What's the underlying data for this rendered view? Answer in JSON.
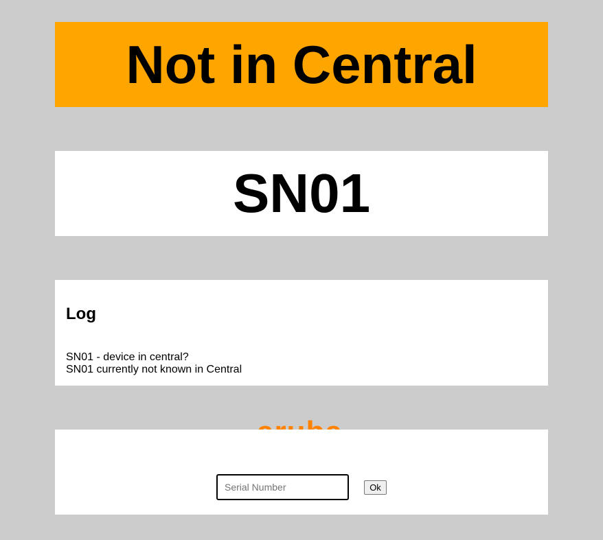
{
  "status": {
    "text": "Not in Central",
    "background": "#ffa500"
  },
  "serial": {
    "value": "SN01"
  },
  "log": {
    "title": "Log",
    "lines": [
      "SN01 - device in central?",
      "SN01 currently not known in Central"
    ]
  },
  "logo": {
    "text": "aruba",
    "color": "#ff8300"
  },
  "form": {
    "input_placeholder": "Serial Number",
    "input_value": "",
    "ok_label": "Ok"
  }
}
